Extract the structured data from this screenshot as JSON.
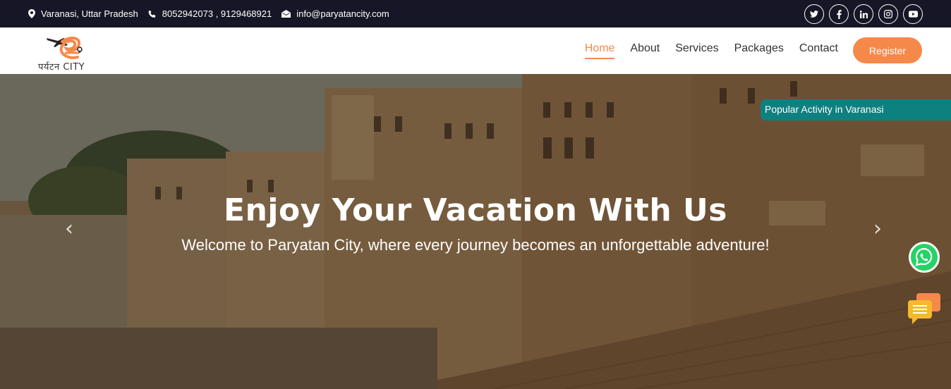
{
  "topbar": {
    "location": "Varanasi, Uttar Pradesh",
    "phone": "8052942073 , 9129468921",
    "email": "info@paryatancity.com",
    "socials": [
      "twitter-icon",
      "facebook-icon",
      "linkedin-icon",
      "instagram-icon",
      "youtube-icon"
    ]
  },
  "logo": {
    "text": "पर्यटन CITY"
  },
  "nav": {
    "items": [
      "Home",
      "About",
      "Services",
      "Packages",
      "Contact"
    ],
    "active": "Home",
    "register": "Register"
  },
  "hero": {
    "title": "Enjoy Your Vacation With Us",
    "subtitle": "Welcome to Paryatan City, where every journey becomes an unforgettable adventure!",
    "prev": "‹",
    "next": "›"
  },
  "popular_activity": "Popular Activity in Varanasi",
  "colors": {
    "accent": "#f5894a",
    "topbar": "#161626",
    "teal": "#0f8080",
    "whatsapp": "#25d366"
  }
}
